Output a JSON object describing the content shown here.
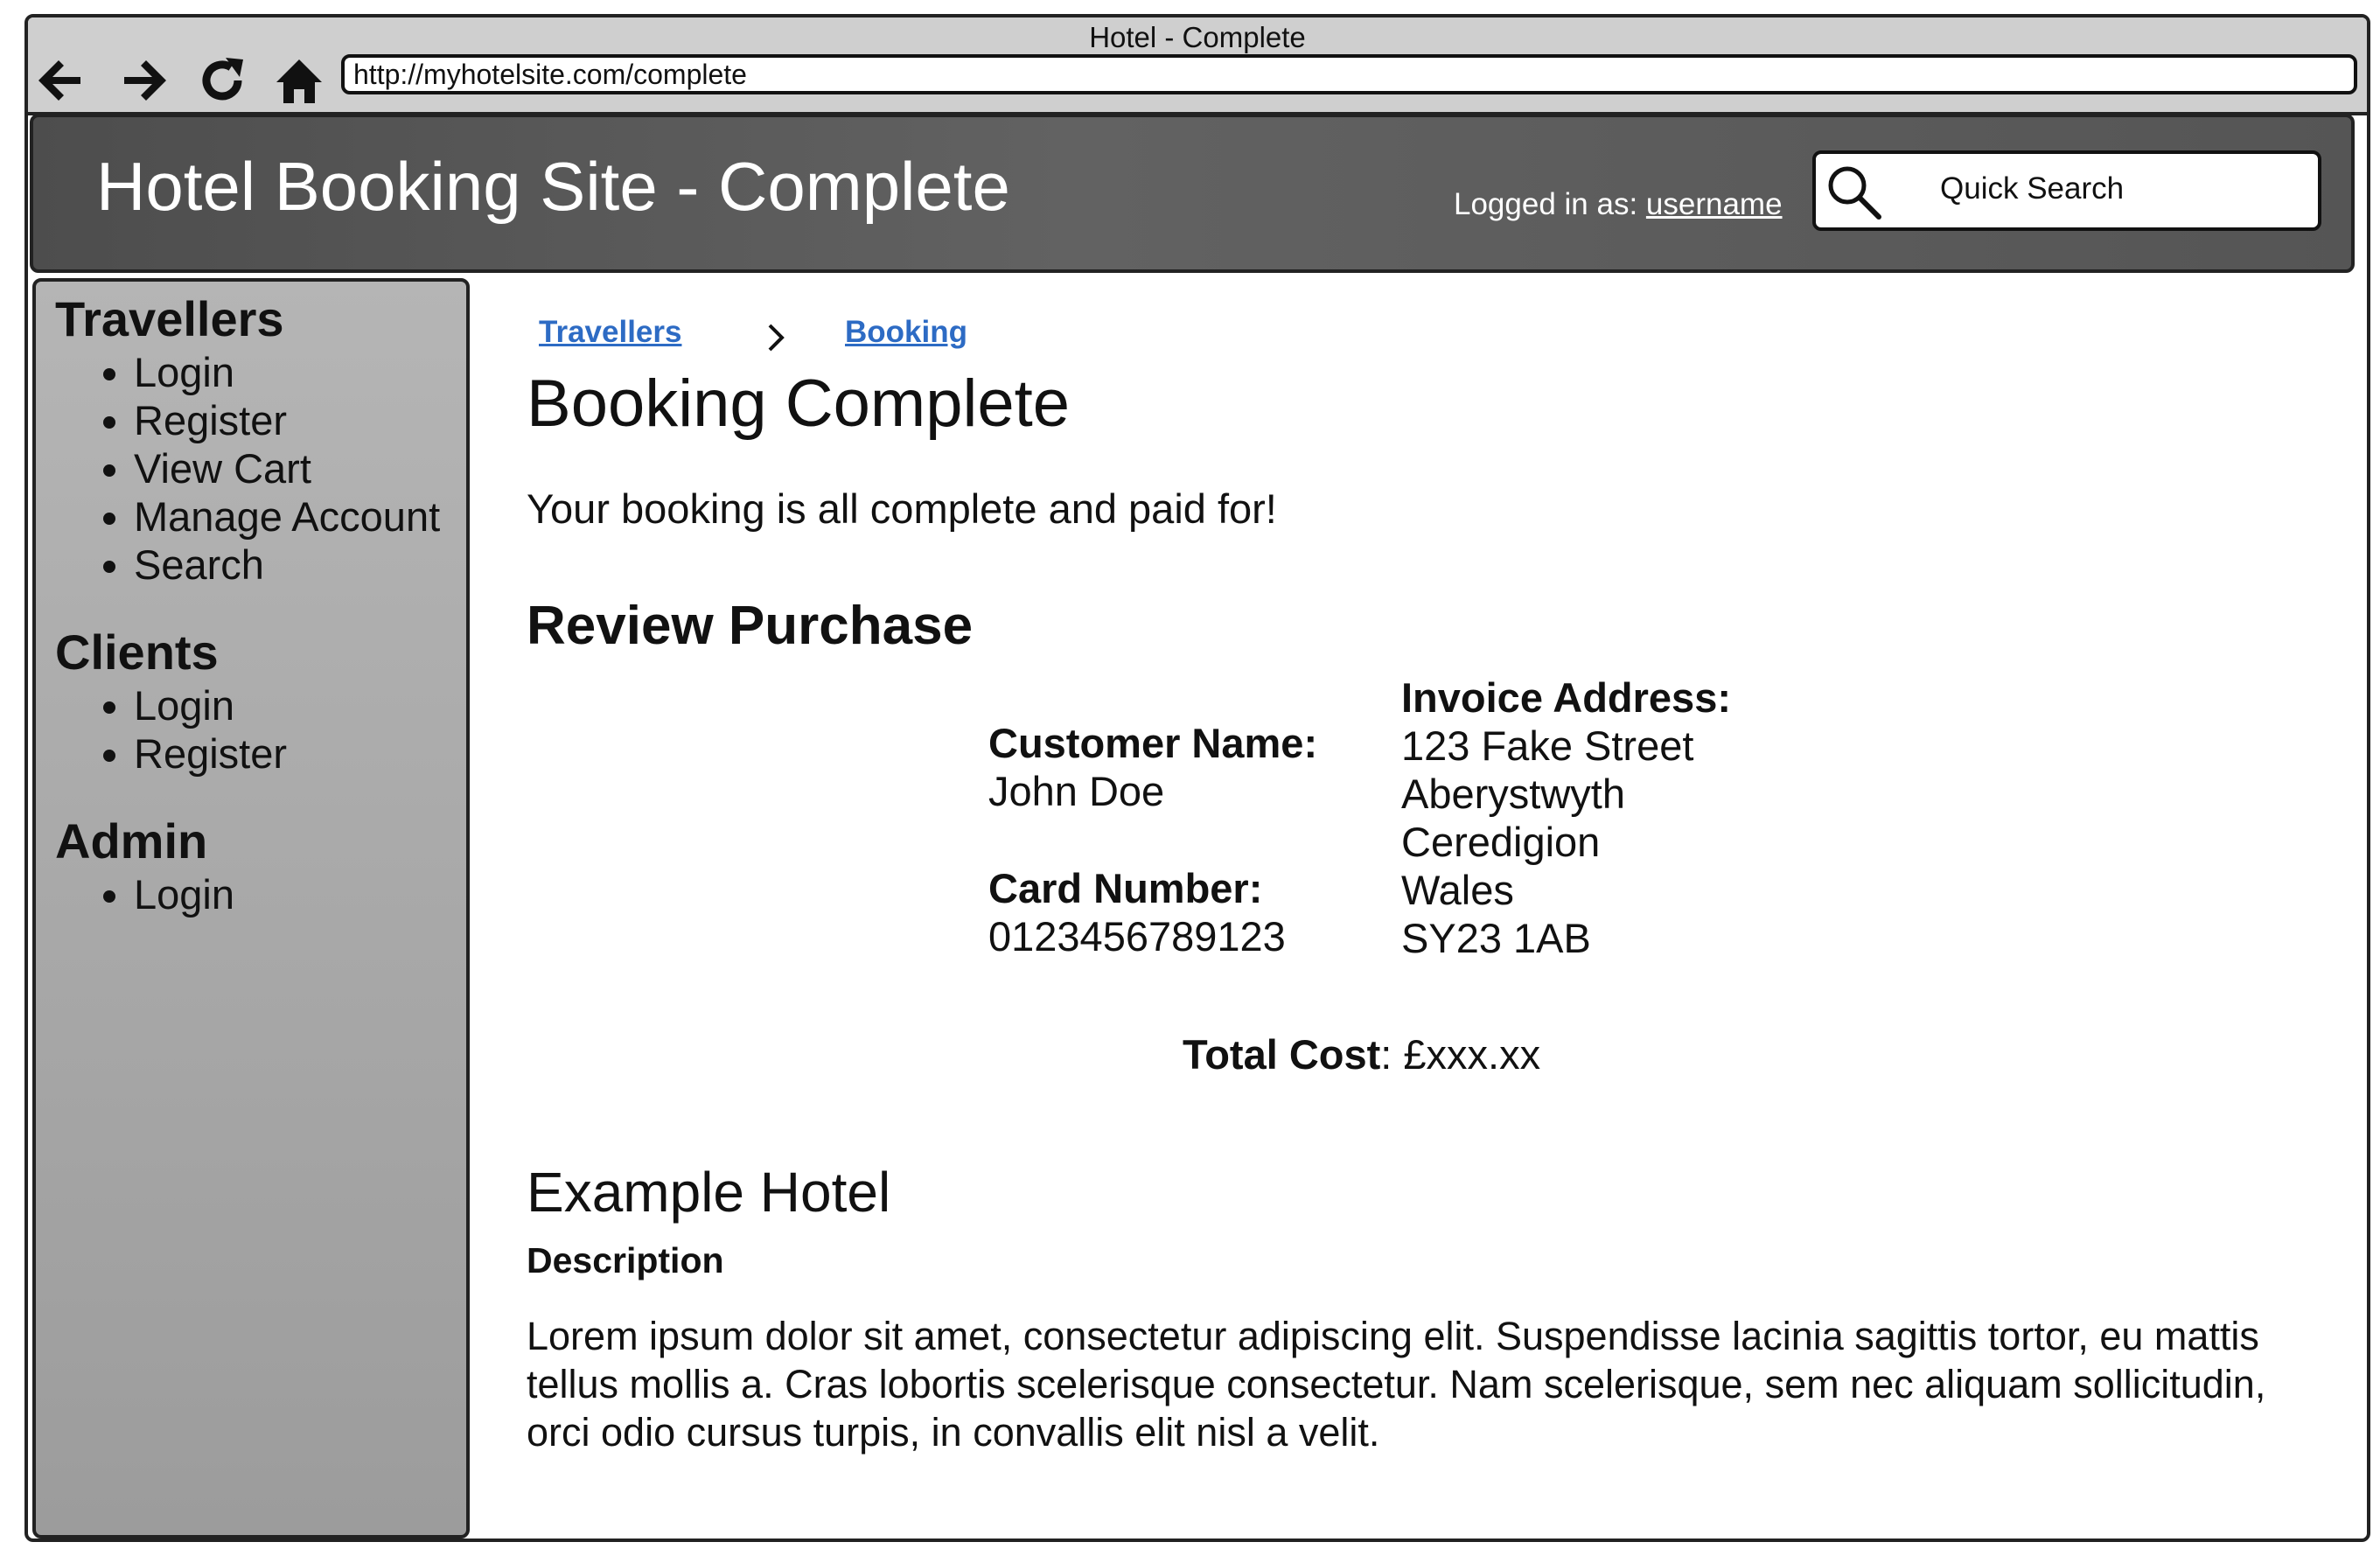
{
  "window": {
    "title": "Hotel - Complete",
    "url": "http://myhotelsite.com/complete",
    "nav": {
      "back_icon": "back-arrow-icon",
      "forward_icon": "forward-arrow-icon",
      "reload_icon": "reload-icon",
      "home_icon": "home-icon"
    }
  },
  "header": {
    "site_title": "Hotel Booking Site - Complete",
    "logged_in_prefix": "Logged in as: ",
    "username": "username",
    "search_placeholder": "Quick Search",
    "search_icon": "search-icon"
  },
  "sidebar": {
    "sections": [
      {
        "heading": "Travellers",
        "items": [
          "Login",
          "Register",
          "View Cart",
          "Manage Account",
          "Search"
        ]
      },
      {
        "heading": "Clients",
        "items": [
          "Login",
          "Register"
        ]
      },
      {
        "heading": "Admin",
        "items": [
          "Login"
        ]
      }
    ]
  },
  "breadcrumb": {
    "items": [
      "Travellers",
      "Booking"
    ]
  },
  "main": {
    "title": "Booking Complete",
    "confirm_text": "Your booking is all complete and paid for!",
    "review_title": "Review Purchase",
    "customer_name_label": "Customer Name:",
    "customer_name": "John Doe",
    "card_number_label": "Card Number:",
    "card_number": "0123456789123",
    "invoice_label": "Invoice Address:",
    "address_lines": [
      "123 Fake Street",
      "Aberystwyth",
      "Ceredigion",
      "Wales",
      "SY23 1AB"
    ],
    "total_label": "Total Cost",
    "total_value": ": £xxx.xx",
    "hotel_name": "Example Hotel",
    "description_label": "Description",
    "description": "Lorem ipsum dolor sit amet, consectetur adipiscing elit. Suspendisse lacinia sagittis tortor, eu mattis tellus mollis a. Cras lobortis scelerisque consectetur. Nam scelerisque, sem nec aliquam sollicitudin, orci odio cursus turpis, in convallis elit nisl a velit."
  }
}
